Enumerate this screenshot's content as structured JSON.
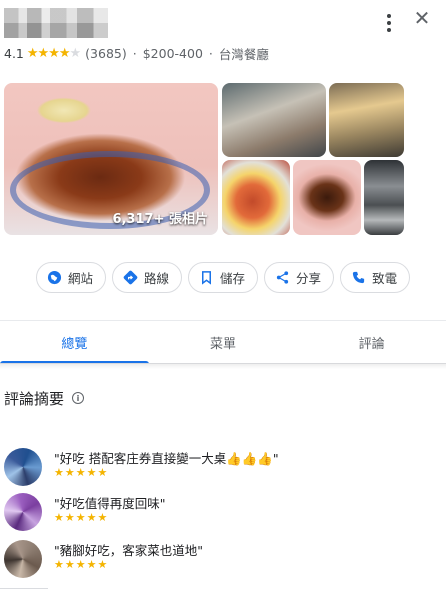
{
  "place": {
    "rating": "4.1",
    "stars_filled": 4,
    "reviews_count": "(3685)",
    "price": "$200-400",
    "category": "台灣餐廳"
  },
  "photos": {
    "count_label": "6,317+ 張相片"
  },
  "actions": [
    {
      "label": "網站",
      "icon": "globe-icon"
    },
    {
      "label": "路線",
      "icon": "directions-icon"
    },
    {
      "label": "儲存",
      "icon": "bookmark-icon"
    },
    {
      "label": "分享",
      "icon": "share-icon"
    },
    {
      "label": "致電",
      "icon": "phone-icon"
    }
  ],
  "tabs": [
    {
      "label": "總覽",
      "active": true
    },
    {
      "label": "菜單",
      "active": false
    },
    {
      "label": "評論",
      "active": false
    }
  ],
  "review_summary": {
    "title": "評論摘要"
  },
  "reviews": [
    {
      "quote": "\"好吃 搭配客庄券直接變一大桌👍👍👍\"",
      "stars": "★★★★★"
    },
    {
      "quote": "\"好吃值得再度回味\"",
      "stars": "★★★★★"
    },
    {
      "quote": "\"豬腳好吃，客家菜也道地\"",
      "stars": "★★★★★"
    }
  ],
  "colors": {
    "accent": "#1a73e8",
    "star": "#f4b400",
    "text_secondary": "#5f6368"
  }
}
